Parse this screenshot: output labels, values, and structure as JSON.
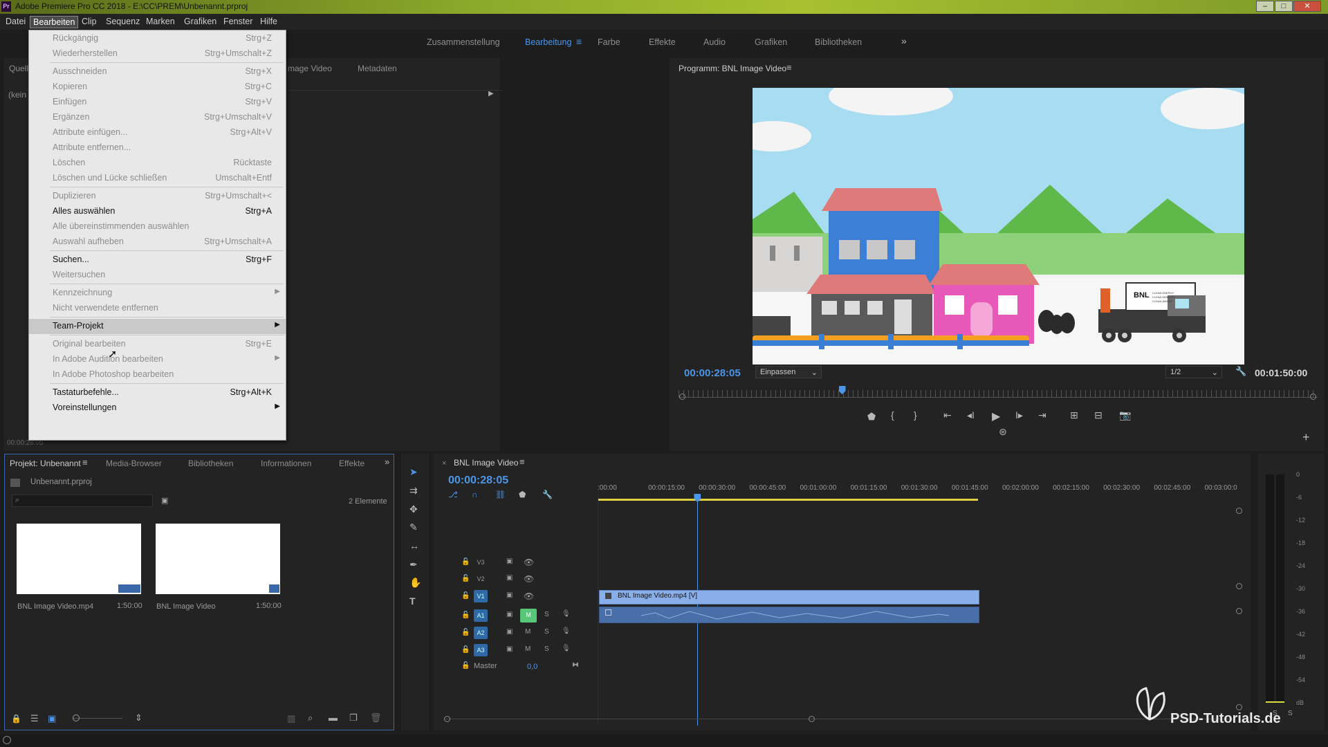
{
  "window": {
    "title": "Adobe Premiere Pro CC 2018 - E:\\CC\\PREM\\Unbenannt.prproj",
    "app_badge": "Pr"
  },
  "menubar": [
    "Datei",
    "Bearbeiten",
    "Clip",
    "Sequenz",
    "Marken",
    "Grafiken",
    "Fenster",
    "Hilfe"
  ],
  "workspaces": [
    "Zusammenstellung",
    "Bearbeitung",
    "Farbe",
    "Effekte",
    "Audio",
    "Grafiken",
    "Bibliotheken"
  ],
  "source_panel": {
    "tab_partial": "Quell",
    "tab2_partial": "mage Video",
    "tab3": "Metadaten",
    "no_clip": "(kein",
    "timecode": "00:00:28:05"
  },
  "edit_menu": [
    {
      "label": "Rückgängig",
      "shortcut": "Strg+Z",
      "enabled": false
    },
    {
      "label": "Wiederherstellen",
      "shortcut": "Strg+Umschalt+Z",
      "enabled": false
    },
    {
      "label": "Ausschneiden",
      "shortcut": "Strg+X",
      "enabled": false
    },
    {
      "label": "Kopieren",
      "shortcut": "Strg+C",
      "enabled": false
    },
    {
      "label": "Einfügen",
      "shortcut": "Strg+V",
      "enabled": false
    },
    {
      "label": "Ergänzen",
      "shortcut": "Strg+Umschalt+V",
      "enabled": false
    },
    {
      "label": "Attribute einfügen...",
      "shortcut": "Strg+Alt+V",
      "enabled": false
    },
    {
      "label": "Attribute entfernen...",
      "shortcut": "",
      "enabled": false
    },
    {
      "label": "Löschen",
      "shortcut": "Rücktaste",
      "enabled": false
    },
    {
      "label": "Löschen und Lücke schließen",
      "shortcut": "Umschalt+Entf",
      "enabled": false
    },
    {
      "label": "Duplizieren",
      "shortcut": "Strg+Umschalt+<",
      "enabled": false
    },
    {
      "label": "Alles auswählen",
      "shortcut": "Strg+A",
      "enabled": true
    },
    {
      "label": "Alle übereinstimmenden auswählen",
      "shortcut": "",
      "enabled": false
    },
    {
      "label": "Auswahl aufheben",
      "shortcut": "Strg+Umschalt+A",
      "enabled": false
    },
    {
      "label": "Suchen...",
      "shortcut": "Strg+F",
      "enabled": true
    },
    {
      "label": "Weitersuchen",
      "shortcut": "",
      "enabled": false
    },
    {
      "label": "Kennzeichnung",
      "shortcut": "",
      "enabled": false,
      "submenu": true
    },
    {
      "label": "Nicht verwendete entfernen",
      "shortcut": "",
      "enabled": false
    },
    {
      "label": "Team-Projekt",
      "shortcut": "",
      "enabled": true,
      "submenu": true,
      "highlighted": true
    },
    {
      "label": "Original bearbeiten",
      "shortcut": "Strg+E",
      "enabled": false
    },
    {
      "label": "In Adobe Audition bearbeiten",
      "shortcut": "",
      "enabled": false,
      "submenu": true
    },
    {
      "label": "In Adobe Photoshop bearbeiten",
      "shortcut": "",
      "enabled": false
    },
    {
      "label": "Tastaturbefehle...",
      "shortcut": "Strg+Alt+K",
      "enabled": true
    },
    {
      "label": "Voreinstellungen",
      "shortcut": "",
      "enabled": true,
      "submenu": true
    }
  ],
  "program_monitor": {
    "title": "Programm: BNL Image Video",
    "timecode_current": "00:00:28:05",
    "fit": "Einpassen",
    "resolution": "1/2",
    "duration": "00:01:50:00",
    "playhead_fraction": 0.256
  },
  "video_frame": {
    "truck_logo": "BNL",
    "truck_lines": [
      "CLEAN ENERGY",
      "CLEAN MOBILITY",
      "CLEAN WATER"
    ]
  },
  "project_panel": {
    "tabs": [
      "Projekt: Unbenannt",
      "Media-Browser",
      "Bibliotheken",
      "Informationen",
      "Effekte"
    ],
    "file": "Unbenannt.prproj",
    "count": "2 Elemente",
    "items": [
      {
        "name": "BNL Image Video.mp4",
        "duration": "1:50:00"
      },
      {
        "name": "BNL Image Video",
        "duration": "1:50:00"
      }
    ]
  },
  "timeline": {
    "title": "BNL Image Video",
    "timecode": "00:00:28:05",
    "ruler": [
      ":00:00",
      "00:00:15:00",
      "00:00:30:00",
      "00:00:45:00",
      "00:01:00:00",
      "00:01:15:00",
      "00:01:30:00",
      "00:01:45:00",
      "00:02:00:00",
      "00:02:15:00",
      "00:02:30:00",
      "00:02:45:00",
      "00:03:00:0"
    ],
    "tracks_video": [
      "V3",
      "V2",
      "V1"
    ],
    "tracks_audio": [
      "A1",
      "A2",
      "A3"
    ],
    "master_label": "Master",
    "master_value": "0,0",
    "clip_name": "BNL Image Video.mp4 [V]",
    "mute": "M",
    "solo": "S"
  },
  "meter_scale": [
    "0",
    "-6",
    "-12",
    "-18",
    "-24",
    "-30",
    "-36",
    "-42",
    "-48",
    "-54",
    "dB"
  ],
  "meter_bottom": [
    "S",
    "S"
  ],
  "watermark": "PSD-Tutorials.de"
}
